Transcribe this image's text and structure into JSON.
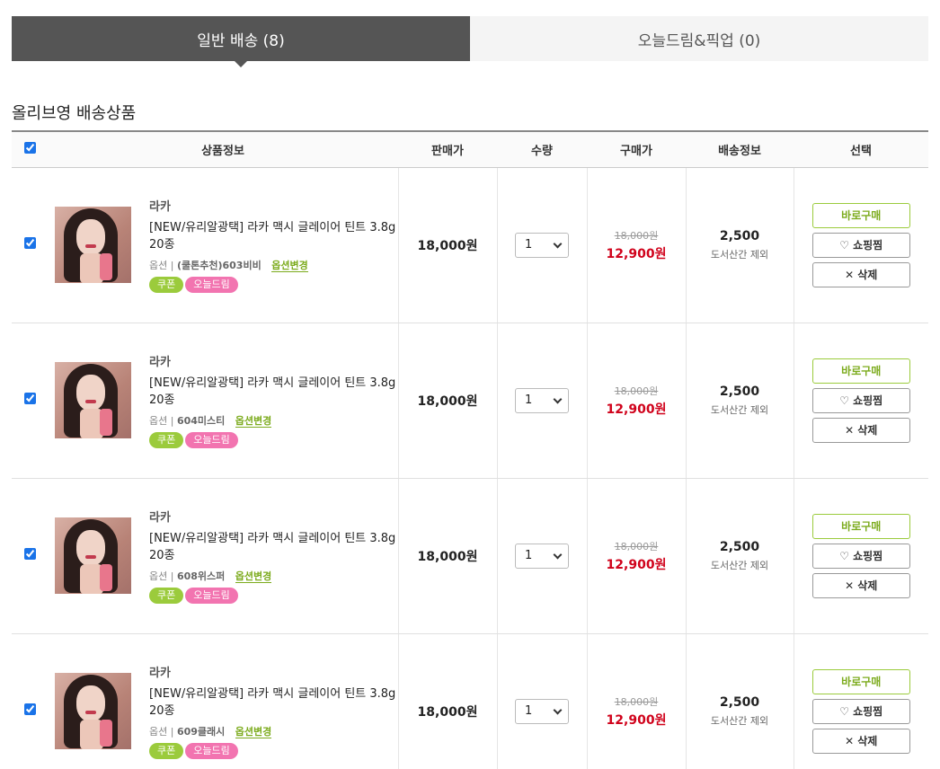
{
  "tabs": [
    {
      "label": "일반 배송 (8)",
      "active": true
    },
    {
      "label": "오늘드림&픽업 (0)",
      "active": false
    }
  ],
  "section_title": "올리브영 배송상품",
  "columns": [
    "상품정보",
    "판매가",
    "수량",
    "구매가",
    "배송정보",
    "선택"
  ],
  "actions": {
    "buy": "바로구매",
    "wish": "쇼핑찜",
    "delete": "삭제"
  },
  "option_label": "옵션 |",
  "option_change": "옵션변경",
  "badges": {
    "coupon": "쿠폰",
    "today": "오늘드림"
  },
  "items": [
    {
      "brand": "라카",
      "name": "[NEW/유리알광택] 라카 맥시 글레이어 틴트 3.8g 20종",
      "option": "(쿨톤추천)603비비",
      "price": "18,000원",
      "qty": "1",
      "orig_price": "18,000원",
      "sale_price": "12,900원",
      "ship_fee": "2,500",
      "ship_note": "도서산간 제외"
    },
    {
      "brand": "라카",
      "name": "[NEW/유리알광택] 라카 맥시 글레이어 틴트 3.8g 20종",
      "option": "604미스티",
      "price": "18,000원",
      "qty": "1",
      "orig_price": "18,000원",
      "sale_price": "12,900원",
      "ship_fee": "2,500",
      "ship_note": "도서산간 제외"
    },
    {
      "brand": "라카",
      "name": "[NEW/유리알광택] 라카 맥시 글레이어 틴트 3.8g 20종",
      "option": "608위스퍼",
      "price": "18,000원",
      "qty": "1",
      "orig_price": "18,000원",
      "sale_price": "12,900원",
      "ship_fee": "2,500",
      "ship_note": "도서산간 제외"
    },
    {
      "brand": "라카",
      "name": "[NEW/유리알광택] 라카 맥시 글레이어 틴트 3.8g 20종",
      "option": "609클래시",
      "price": "18,000원",
      "qty": "1",
      "orig_price": "18,000원",
      "sale_price": "12,900원",
      "ship_fee": "2,500",
      "ship_note": "도서산간 제외"
    }
  ]
}
